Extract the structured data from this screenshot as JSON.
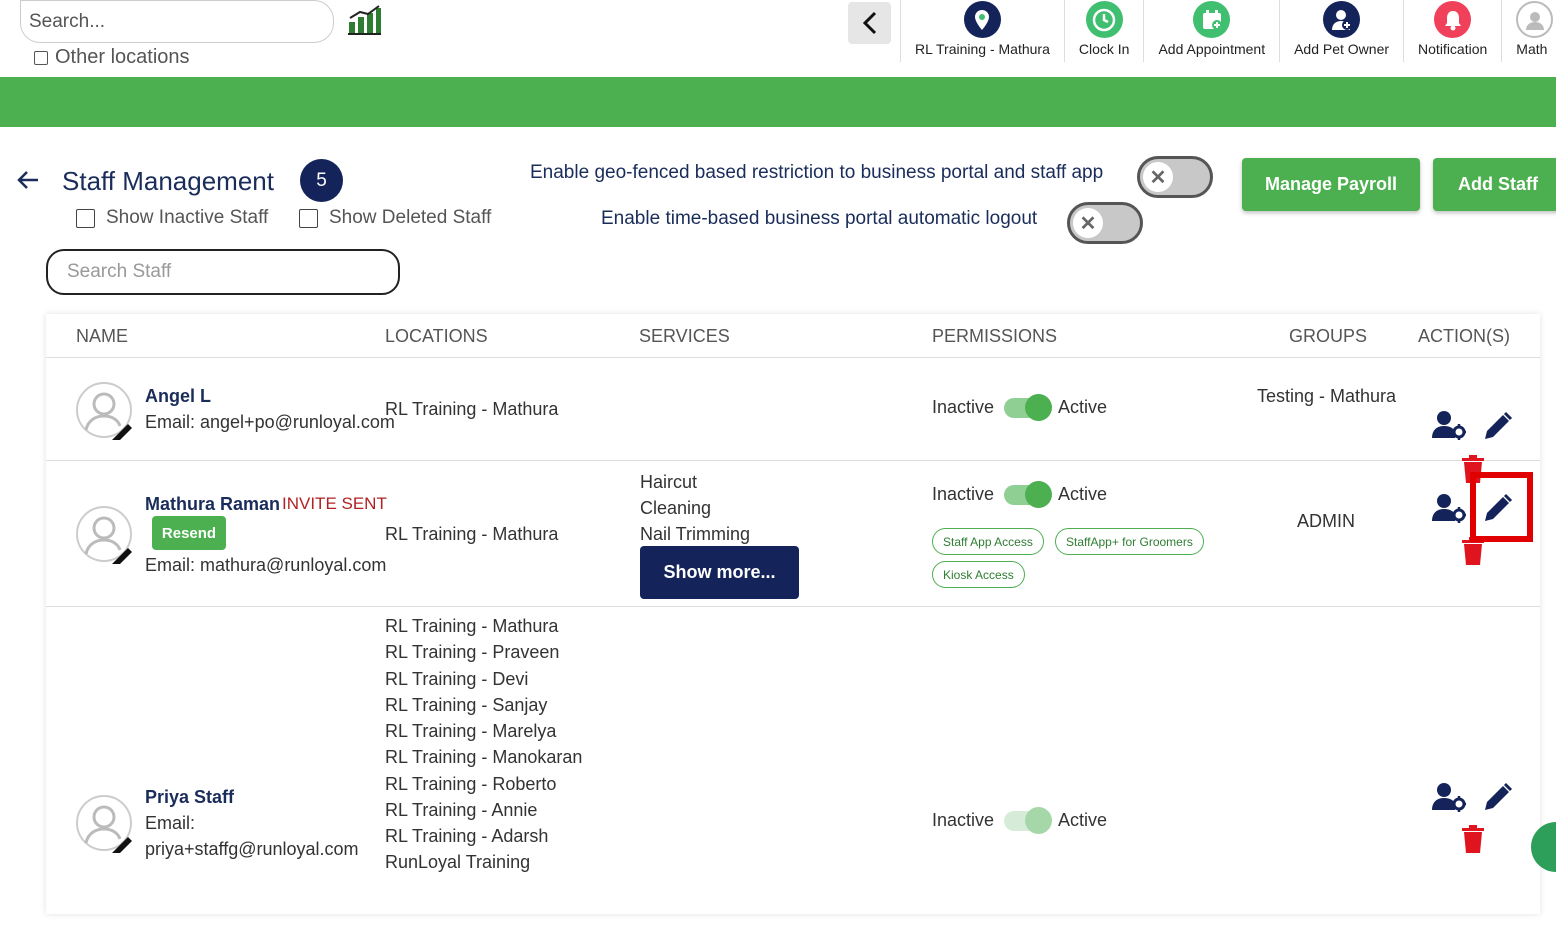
{
  "topbar": {
    "search_placeholder": "Search...",
    "other_locations_label": "Other locations",
    "nav_items": [
      {
        "label": "RL Training - Mathura",
        "icon": "location-pin-icon",
        "color": "#14235a"
      },
      {
        "label": "Clock In",
        "icon": "clock-icon",
        "color": "#3fbf6f"
      },
      {
        "label": "Add Appointment",
        "icon": "calendar-add-icon",
        "color": "#3fbf6f"
      },
      {
        "label": "Add Pet Owner",
        "icon": "user-add-icon",
        "color": "#14235a"
      },
      {
        "label": "Notification",
        "icon": "bell-icon",
        "color": "#f0405a"
      },
      {
        "label": "Math",
        "icon": "user-avatar-icon",
        "color": "#cccccc"
      }
    ]
  },
  "header": {
    "title": "Staff Management",
    "count": "5",
    "show_inactive_label": "Show Inactive Staff",
    "show_deleted_label": "Show Deleted Staff",
    "geo_fence_label": "Enable geo-fenced based restriction to business portal and staff app",
    "auto_logout_label": "Enable time-based business portal automatic logout",
    "manage_payroll_label": "Manage Payroll",
    "add_staff_label": "Add Staff",
    "search_staff_placeholder": "Search Staff"
  },
  "table": {
    "columns": [
      "NAME",
      "LOCATIONS",
      "SERVICES",
      "PERMISSIONS",
      "GROUPS",
      "ACTION(S)"
    ],
    "inactive_label": "Inactive",
    "active_label": "Active",
    "rows": [
      {
        "name": "Angel L",
        "email": "Email: angel+po@runloyal.com",
        "locations": [
          "RL Training - Mathura"
        ],
        "services": [],
        "group": "Testing - Mathura"
      },
      {
        "name": "Mathura Raman",
        "invite": "INVITE SENT",
        "resend_label": "Resend",
        "email": "Email: mathura@runloyal.com",
        "locations": [
          "RL Training - Mathura"
        ],
        "services": [
          "Haircut",
          "Cleaning",
          "Nail Trimming"
        ],
        "show_more_label": "Show more...",
        "chips": [
          "Staff App Access",
          "StaffApp+ for Groomers",
          "Kiosk Access"
        ],
        "group": "ADMIN"
      },
      {
        "name": "Priya Staff",
        "email_label": "Email:",
        "email": "priya+staffg@runloyal.com",
        "locations": [
          "RL Training - Mathura",
          "RL Training - Praveen",
          "RL Training - Devi",
          "RL Training - Sanjay",
          "RL Training - Marelya",
          "RL Training - Manokaran",
          "RL Training - Roberto",
          "RL Training - Annie",
          "RL Training - Adarsh",
          "RunLoyal Training"
        ],
        "services": [],
        "group": ""
      }
    ]
  },
  "colors": {
    "primary_green": "#4caf50",
    "navy": "#14235a",
    "delete_red": "#e0141e",
    "highlight_red": "#e00000"
  }
}
